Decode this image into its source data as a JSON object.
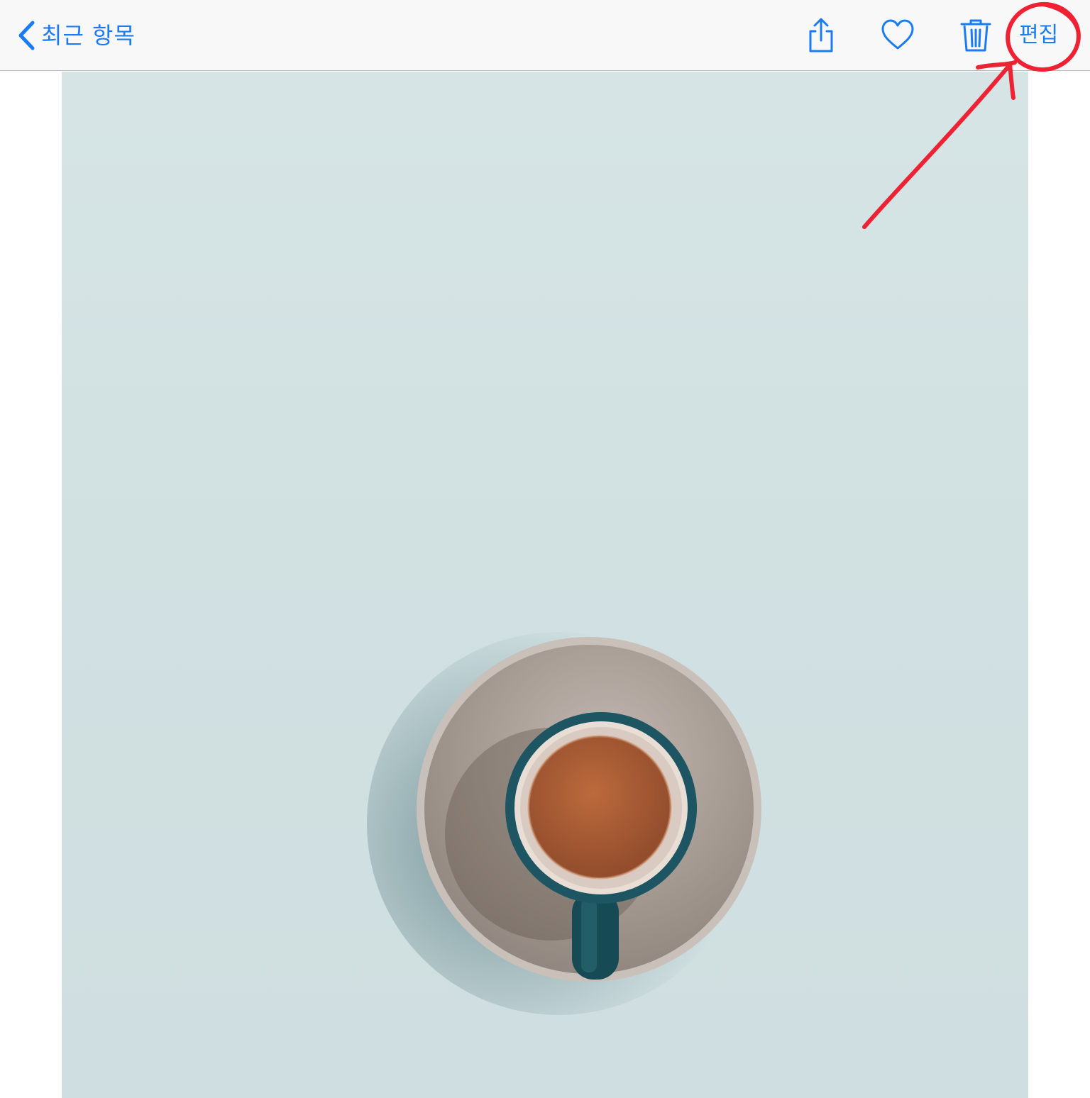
{
  "navbar": {
    "back_label": "최근 항목",
    "edit_label": "편집",
    "icons": [
      "chevron-left-icon",
      "share-icon",
      "heart-icon",
      "trash-icon"
    ]
  },
  "colors": {
    "accent": "#1a7cf5",
    "navbar_background": "#f8f8f8",
    "photo_background": "#d3e2e3",
    "annotation_red": "#ee2233"
  },
  "photo": {
    "subject": "coffee-cup-on-saucer"
  },
  "annotation": {
    "type": "hand-drawn circle and arrow",
    "target": "edit-button"
  }
}
